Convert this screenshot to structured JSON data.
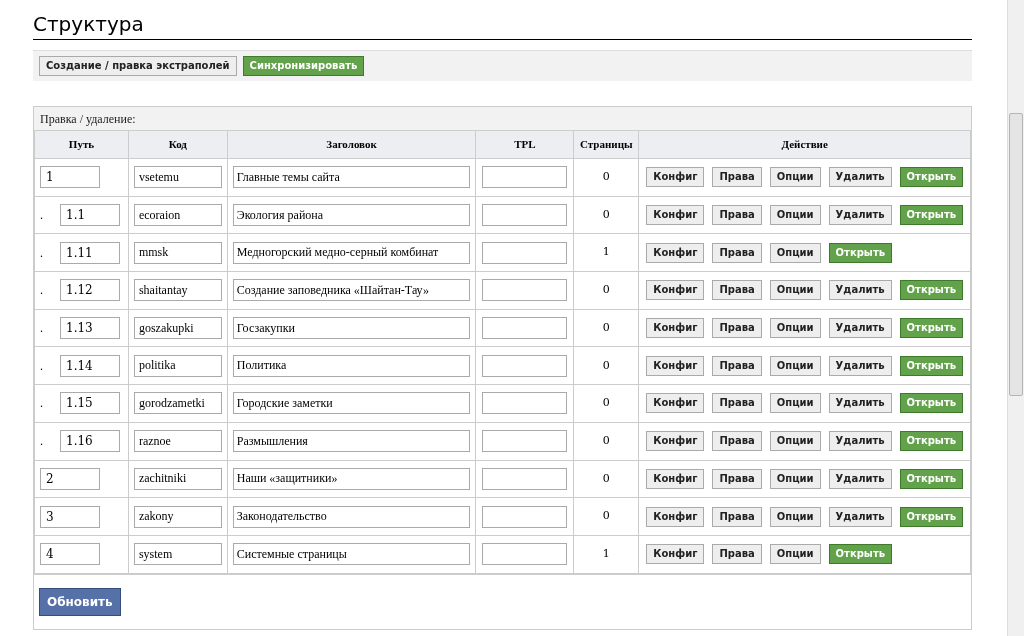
{
  "page": {
    "title": "Структура"
  },
  "toolbar": {
    "buttons": [
      {
        "label": "Создание / правка экстраполей",
        "kind": "plain"
      },
      {
        "label": "Синхронизировать",
        "kind": "primary"
      }
    ]
  },
  "structure": {
    "caption": "Правка / удаление:",
    "columns": [
      "Путь",
      "Код",
      "Заголовок",
      "TPL",
      "Страницы",
      "Действие"
    ],
    "rows": [
      {
        "path": "1",
        "code": "vsetemu",
        "title": "Главные темы сайта",
        "pages": "0",
        "buttons": [
          {
            "label": "Конфиг",
            "kind": "plain"
          },
          {
            "label": "Права",
            "kind": "plain"
          },
          {
            "label": "Опции",
            "kind": "plain"
          },
          {
            "label": "Удалить",
            "kind": "plain"
          },
          {
            "label": "Открыть",
            "kind": "open"
          }
        ],
        "children": [
          {
            "marker": ".",
            "path": "1.1",
            "code": "ecoraion",
            "title": "Экология района",
            "pages": "0",
            "buttons": [
              {
                "label": "Конфиг",
                "kind": "plain"
              },
              {
                "label": "Права",
                "kind": "plain"
              },
              {
                "label": "Опции",
                "kind": "plain"
              },
              {
                "label": "Удалить",
                "kind": "plain"
              },
              {
                "label": "Открыть",
                "kind": "open"
              }
            ]
          },
          {
            "marker": ".",
            "path": "1.11",
            "code": "mmsk",
            "title": "Медногорский медно-серный комбинат",
            "pages": "1",
            "buttons": [
              {
                "label": "Конфиг",
                "kind": "plain"
              },
              {
                "label": "Права",
                "kind": "plain"
              },
              {
                "label": "Опции",
                "kind": "plain"
              },
              {
                "label": "Открыть",
                "kind": "open"
              }
            ]
          },
          {
            "marker": ".",
            "path": "1.12",
            "code": "shaitantay",
            "title": "Создание заповедника «Шайтан-Тау»",
            "pages": "0",
            "buttons": [
              {
                "label": "Конфиг",
                "kind": "plain"
              },
              {
                "label": "Права",
                "kind": "plain"
              },
              {
                "label": "Опции",
                "kind": "plain"
              },
              {
                "label": "Удалить",
                "kind": "plain"
              },
              {
                "label": "Открыть",
                "kind": "open"
              }
            ]
          },
          {
            "marker": ".",
            "path": "1.13",
            "code": "goszakupki",
            "title": "Госзакупки",
            "pages": "0",
            "buttons": [
              {
                "label": "Конфиг",
                "kind": "plain"
              },
              {
                "label": "Права",
                "kind": "plain"
              },
              {
                "label": "Опции",
                "kind": "plain"
              },
              {
                "label": "Удалить",
                "kind": "plain"
              },
              {
                "label": "Открыть",
                "kind": "open"
              }
            ]
          },
          {
            "marker": ".",
            "path": "1.14",
            "code": "politika",
            "title": "Политика",
            "pages": "0",
            "buttons": [
              {
                "label": "Конфиг",
                "kind": "plain"
              },
              {
                "label": "Права",
                "kind": "plain"
              },
              {
                "label": "Опции",
                "kind": "plain"
              },
              {
                "label": "Удалить",
                "kind": "plain"
              },
              {
                "label": "Открыть",
                "kind": "open"
              }
            ]
          },
          {
            "marker": ".",
            "path": "1.15",
            "code": "gorodzametki",
            "title": "Городские заметки",
            "pages": "0",
            "buttons": [
              {
                "label": "Конфиг",
                "kind": "plain"
              },
              {
                "label": "Права",
                "kind": "plain"
              },
              {
                "label": "Опции",
                "kind": "plain"
              },
              {
                "label": "Удалить",
                "kind": "plain"
              },
              {
                "label": "Открыть",
                "kind": "open"
              }
            ]
          },
          {
            "marker": ".",
            "path": "1.16",
            "code": "raznoe",
            "title": "Размышления",
            "pages": "0",
            "buttons": [
              {
                "label": "Конфиг",
                "kind": "plain"
              },
              {
                "label": "Права",
                "kind": "plain"
              },
              {
                "label": "Опции",
                "kind": "plain"
              },
              {
                "label": "Удалить",
                "kind": "plain"
              },
              {
                "label": "Открыть",
                "kind": "open"
              }
            ]
          }
        ]
      },
      {
        "path": "2",
        "code": "zachitniki",
        "title": "Наши «защитники»",
        "pages": "0",
        "buttons": [
          {
            "label": "Конфиг",
            "kind": "plain"
          },
          {
            "label": "Права",
            "kind": "plain"
          },
          {
            "label": "Опции",
            "kind": "plain"
          },
          {
            "label": "Удалить",
            "kind": "plain"
          },
          {
            "label": "Открыть",
            "kind": "open"
          }
        ]
      },
      {
        "path": "3",
        "code": "zakony",
        "title": "Законодательство",
        "pages": "0",
        "buttons": [
          {
            "label": "Конфиг",
            "kind": "plain"
          },
          {
            "label": "Права",
            "kind": "plain"
          },
          {
            "label": "Опции",
            "kind": "plain"
          },
          {
            "label": "Удалить",
            "kind": "plain"
          },
          {
            "label": "Открыть",
            "kind": "open"
          }
        ]
      },
      {
        "path": "4",
        "code": "system",
        "title": "Системные страницы",
        "pages": "1",
        "buttons": [
          {
            "label": "Конфиг",
            "kind": "plain"
          },
          {
            "label": "Права",
            "kind": "plain"
          },
          {
            "label": "Опции",
            "kind": "plain"
          },
          {
            "label": "Открыть",
            "kind": "open"
          }
        ]
      }
    ],
    "submit": {
      "label": "Обновить"
    }
  }
}
